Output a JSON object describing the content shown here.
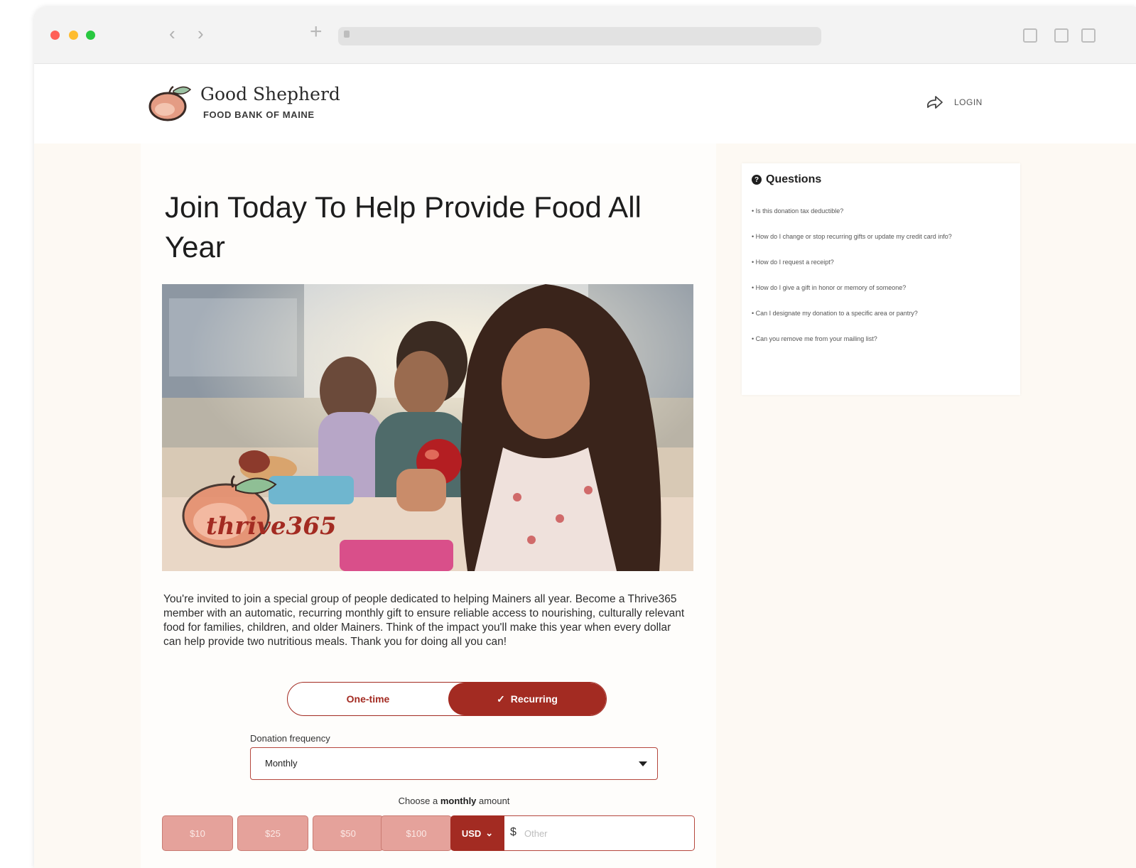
{
  "browser": {
    "back": "‹",
    "forward": "›",
    "new_tab": "+"
  },
  "header": {
    "logo_title": "Good Shepherd",
    "logo_subtitle": "FOOD BANK OF MAINE",
    "login": "LOGIN"
  },
  "main": {
    "headline": "Join Today To Help Provide Food All Year",
    "hero_logo_text": "thrive365",
    "intro": "You're invited to join a special group of people dedicated to helping Mainers all year. Become a Thrive365 member with an automatic, recurring monthly gift to ensure reliable access to nourishing, culturally relevant food for families, children, and older Mainers. Think of the impact you'll make this year when every dollar can help provide two nutritious meals. Thank you for doing all you can!",
    "toggle": {
      "one_time": "One-time",
      "recurring": "Recurring",
      "selected": "Recurring"
    },
    "frequency_label": "Donation frequency",
    "frequency_value": "Monthly",
    "amount_hint_prefix": "Choose a",
    "amount_hint_bold": "monthly",
    "amount_hint_suffix": "amount",
    "amounts": [
      "$10",
      "$25",
      "$50",
      "$100"
    ],
    "currency": "USD",
    "dollar_sign": "$",
    "other_placeholder": "Other"
  },
  "faq": {
    "title": "Questions",
    "items": [
      "• Is this donation tax deductible?",
      "• How do I change or stop recurring gifts or update my credit card info?",
      "• How do I request a receipt?",
      "• How do I give a gift in honor or memory of someone?",
      "• Can I designate my donation to a specific area or pantry?",
      "• Can you remove me from your mailing list?"
    ]
  },
  "colors": {
    "brand_red": "#a32b22",
    "amount_disabled": "#e5a29b",
    "page_bg": "#fdf9f3"
  },
  "icons": {
    "login": "share-arrow-icon",
    "question": "question-circle-icon",
    "dropdown": "caret-down-icon",
    "check": "check-icon"
  }
}
